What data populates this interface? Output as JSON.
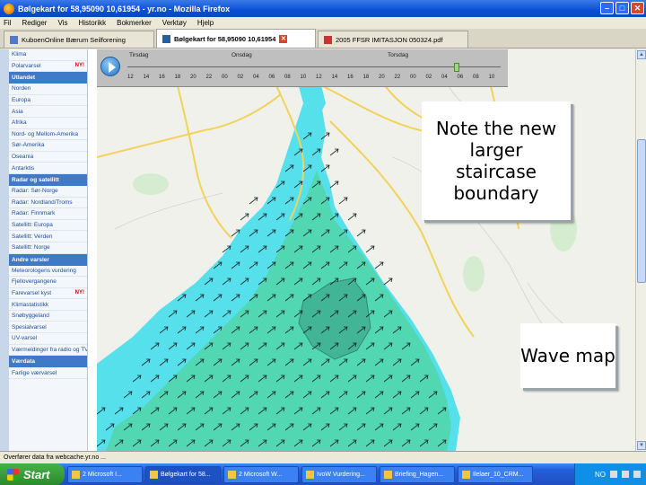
{
  "window": {
    "title": "Bølgekart for 58,95090 10,61954 - yr.no - Mozilla Firefox"
  },
  "menu": [
    "Fil",
    "Rediger",
    "Vis",
    "Historikk",
    "Bokmerker",
    "Verktøy",
    "Hjelp"
  ],
  "tabs": [
    {
      "label": "KuboenOnline Bærum Seilforening",
      "active": false
    },
    {
      "label": "Bølgekart for 58,95090 10,61954",
      "active": true
    },
    {
      "label": "2005 FFSR IMITASJON 050324.pdf",
      "active": false
    }
  ],
  "sidebar": {
    "items": [
      {
        "type": "item",
        "label": "Klima",
        "new": false
      },
      {
        "type": "item",
        "label": "Polarvarsel",
        "new": true
      },
      {
        "type": "head",
        "label": "Utlandet"
      },
      {
        "type": "item",
        "label": "Norden",
        "new": false
      },
      {
        "type": "item",
        "label": "Europa",
        "new": false
      },
      {
        "type": "item",
        "label": "Asia",
        "new": false
      },
      {
        "type": "item",
        "label": "Afrika",
        "new": false
      },
      {
        "type": "item",
        "label": "Nord- og Mellom-Amerika",
        "new": false
      },
      {
        "type": "item",
        "label": "Sør-Amerika",
        "new": false
      },
      {
        "type": "item",
        "label": "Oseania",
        "new": false
      },
      {
        "type": "item",
        "label": "Antarktis",
        "new": false
      },
      {
        "type": "head",
        "label": "Radar og satellitt"
      },
      {
        "type": "item",
        "label": "Radar: Sør-Norge",
        "new": false
      },
      {
        "type": "item",
        "label": "Radar: Nordland/Troms",
        "new": false
      },
      {
        "type": "item",
        "label": "Radar: Finnmark",
        "new": false
      },
      {
        "type": "item",
        "label": "Satellitt: Europa",
        "new": false
      },
      {
        "type": "item",
        "label": "Satellitt: Verden",
        "new": false
      },
      {
        "type": "item",
        "label": "Satellitt: Norge",
        "new": false
      },
      {
        "type": "head",
        "label": "Andre varsler"
      },
      {
        "type": "item",
        "label": "Meteorologens vurdering",
        "new": false
      },
      {
        "type": "item",
        "label": "Fjellovergangene",
        "new": false
      },
      {
        "type": "item",
        "label": "Farevarsel kyst",
        "new": true
      },
      {
        "type": "item",
        "label": "Klimastatistikk",
        "new": false
      },
      {
        "type": "item",
        "label": "Snøbyggeland",
        "new": false
      },
      {
        "type": "item",
        "label": "Spesialvarsel",
        "new": false
      },
      {
        "type": "item",
        "label": "UV-varsel",
        "new": false
      },
      {
        "type": "item",
        "label": "Værmeldinger fra radio og TV",
        "new": false
      },
      {
        "type": "head",
        "label": "Værdata"
      },
      {
        "type": "item",
        "label": "Farlige værvarsel",
        "new": false
      }
    ],
    "new_badge": "NY!"
  },
  "timeline": {
    "days": [
      "Tirsdag",
      "Onsdag",
      "Torsdag"
    ],
    "hours": [
      "12",
      "14",
      "16",
      "18",
      "20",
      "22",
      "00",
      "02",
      "04",
      "06",
      "08",
      "10",
      "12",
      "14",
      "16",
      "18",
      "20",
      "22",
      "00",
      "02",
      "04",
      "06",
      "08",
      "10"
    ]
  },
  "callouts": {
    "staircase": "Note the new larger staircase boundary",
    "wave": "Wave map"
  },
  "statusbar": {
    "text": "Overfører data fra webcache.yr.no ..."
  },
  "taskbar": {
    "start": "Start",
    "tasks": [
      {
        "label": "2 Microsoft I...",
        "active": false
      },
      {
        "label": "Bølgekart for 58...",
        "active": true
      },
      {
        "label": "2 Microsoft W...",
        "active": false
      },
      {
        "label": "IvoW Vurdering...",
        "active": false
      },
      {
        "label": "Briefing_Hagen...",
        "active": false
      },
      {
        "label": "Ilelaer_10_CRM...",
        "active": false
      }
    ],
    "lang": "NO"
  },
  "colors": {
    "sea_cyan": "#55e0ec",
    "sea_green": "#52d6b0",
    "land": "#f1f1ec",
    "road": "#f2d259",
    "xp_blue": "#245edb"
  }
}
